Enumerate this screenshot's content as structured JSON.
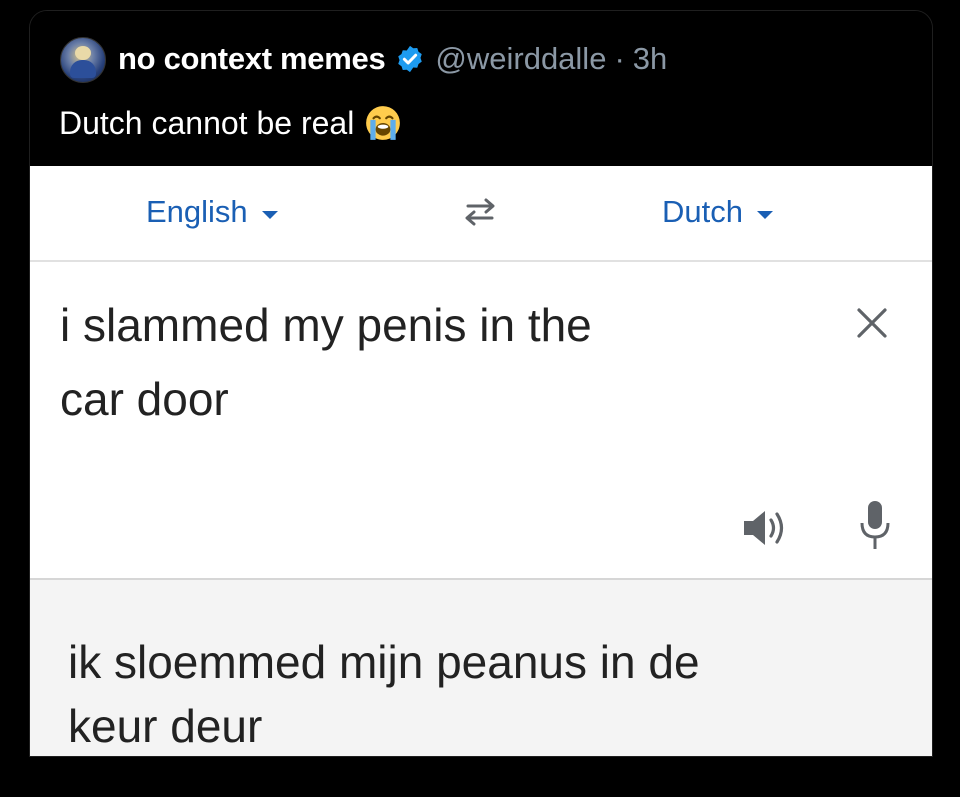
{
  "tweet": {
    "display_name": "no context memes",
    "handle": "@weirddalle",
    "separator": "·",
    "time": "3h",
    "text": "Dutch cannot be real",
    "verified_icon": "verified-badge-icon",
    "emoji_icon": "loudly-crying-face-icon",
    "colors": {
      "background": "#000000",
      "primary_text": "#ffffff",
      "secondary_text": "#8b98a5",
      "verified": "#1d9bf0"
    }
  },
  "translate": {
    "source_language": "English",
    "target_language": "Dutch",
    "swap_icon": "swap-arrows-icon",
    "source_text_line1": "i slammed my penis in the",
    "source_text_line2": "car door",
    "clear_icon": "close-icon",
    "listen_icon": "speaker-icon",
    "voice_icon": "microphone-icon",
    "result_text_line1": "ik sloemmed mijn peanus in de",
    "result_text_line2": "keur deur",
    "colors": {
      "language_link": "#1a5fb4",
      "text": "#222222",
      "result_background": "#f4f4f4"
    }
  }
}
